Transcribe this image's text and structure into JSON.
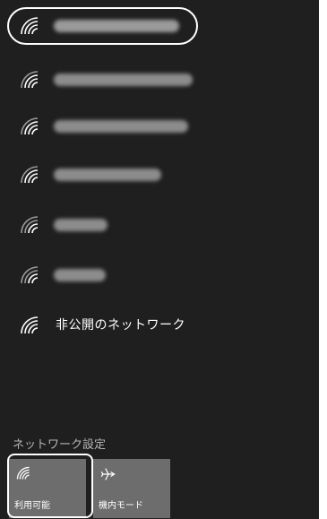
{
  "networks": [
    {
      "label_hidden": true,
      "shade": "#9a9a9a",
      "bar": 140
    },
    {
      "label_hidden": true,
      "shade": "#8c8c8c",
      "bar": 155
    },
    {
      "label_hidden": true,
      "shade": "#8c8c8c",
      "bar": 150
    },
    {
      "label_hidden": true,
      "shade": "#8c8c8c",
      "bar": 120
    },
    {
      "label_hidden": true,
      "shade": "#8c8c8c",
      "bar": 60
    },
    {
      "label_hidden": true,
      "shade": "#8c8c8c",
      "bar": 58
    },
    {
      "label_hidden": false,
      "name": "非公開のネットワーク"
    }
  ],
  "settings": {
    "link_label": "ネットワーク設定"
  },
  "tiles": {
    "wifi": {
      "label": "利用可能",
      "icon": "wifi-icon"
    },
    "airplane": {
      "label": "機内モード",
      "icon": "airplane-icon"
    }
  },
  "colors": {
    "panel": "#1f1f1f",
    "tile": "#6d6d6d",
    "text": "#ffffff"
  }
}
